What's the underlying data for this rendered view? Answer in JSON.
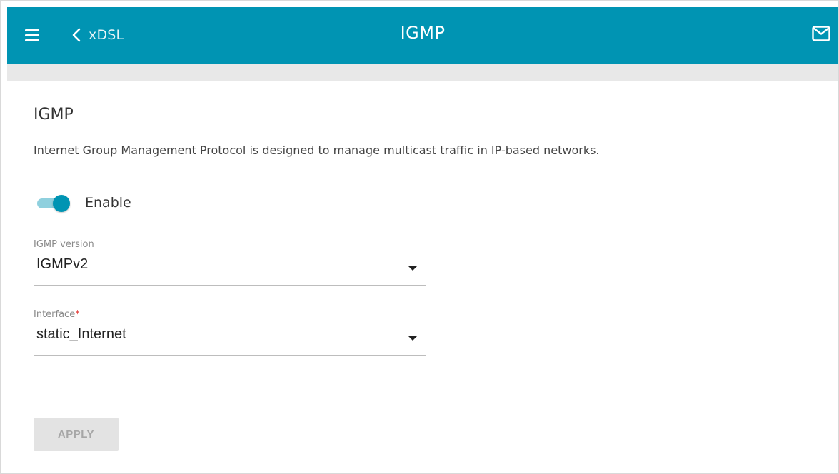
{
  "header": {
    "back_label": "xDSL",
    "title": "IGMP",
    "icons": {
      "menu": "hamburger-menu-icon",
      "back": "chevron-left-icon",
      "messages": "mail-icon"
    },
    "background_color": "#0094b3"
  },
  "section": {
    "title": "IGMP",
    "description": "Internet Group Management Protocol is designed to manage multicast traffic in IP-based networks."
  },
  "enable_toggle": {
    "label": "Enable",
    "state": "on",
    "accent_color": "#0094b3"
  },
  "igmp_version": {
    "label": "IGMP version",
    "value": "IGMPv2"
  },
  "interface": {
    "label": "Interface",
    "required_mark": "*",
    "value": "static_Internet"
  },
  "apply_button": {
    "label": "APPLY",
    "state": "disabled"
  }
}
